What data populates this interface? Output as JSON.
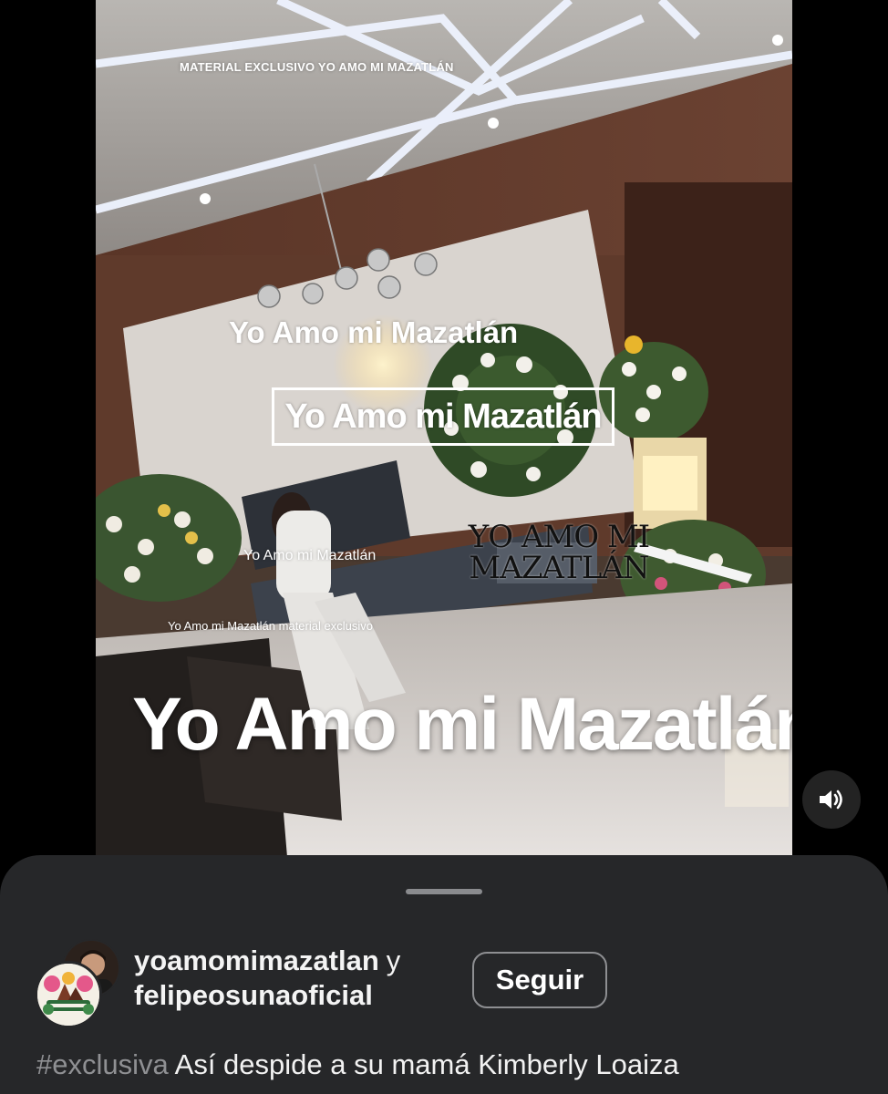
{
  "video": {
    "watermark_top": "MATERIAL EXCLUSIVO YO AMO MI MAZATLÁN",
    "watermark_mid": "Yo Amo mi Mazatlán",
    "watermark_boxed": "Yo Amo mi Mazatlán",
    "watermark_small": "Yo Amo mi Mazatlán",
    "watermark_small_exclusive": "Yo Amo mi Mazatlán material exclusivo",
    "watermark_serif": "YO AMO MI MAZATLÁN",
    "watermark_big": "Yo Amo mi Mazatlán",
    "sound_icon": "speaker-volume-icon"
  },
  "sheet": {
    "author_primary": "yoamomimazatlan",
    "author_join": "y",
    "author_secondary": "felipeosunaoficial",
    "follow_label": "Seguir",
    "hashtag": "#exclusiva",
    "caption_text": "Así despide a su mamá Kimberly Loaiza"
  },
  "colors": {
    "sheet_bg": "#262729",
    "hashtag": "#8f9093",
    "text": "#f2f2f2"
  }
}
